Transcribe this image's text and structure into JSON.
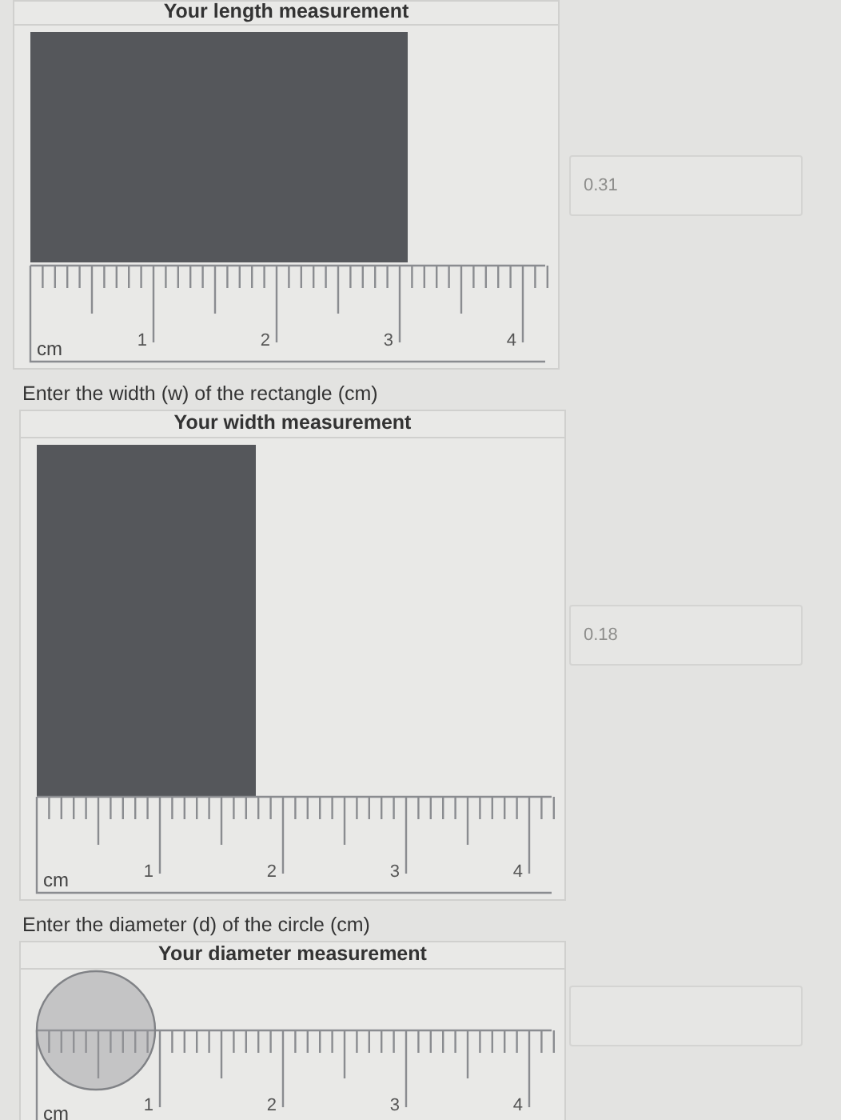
{
  "sections": [
    {
      "header": "Your length measurement",
      "shape": {
        "kind": "wide-rectangle"
      },
      "ruler": {
        "unit": "cm",
        "labels": [
          "1",
          "2",
          "3",
          "4"
        ]
      },
      "answer": {
        "placeholder": "0.31"
      }
    },
    {
      "prompt": "Enter the width (w) of the rectangle (cm)",
      "header": "Your width measurement",
      "shape": {
        "kind": "tall-rectangle"
      },
      "ruler": {
        "unit": "cm",
        "labels": [
          "1",
          "2",
          "3",
          "4"
        ]
      },
      "answer": {
        "placeholder": "0.18"
      }
    },
    {
      "prompt": "Enter the diameter (d) of the circle (cm)",
      "header": "Your diameter measurement",
      "shape": {
        "kind": "circle"
      },
      "ruler": {
        "unit": "cm",
        "labels": [
          "1",
          "2",
          "3",
          "4"
        ]
      }
    }
  ]
}
